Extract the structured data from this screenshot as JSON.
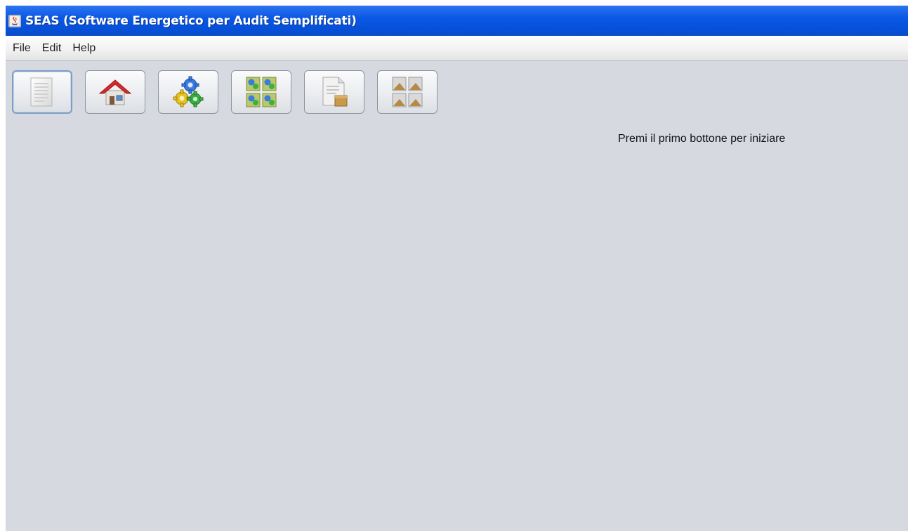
{
  "window": {
    "title": "SEAS (Software Energetico per Audit Semplificati)"
  },
  "menubar": {
    "items": [
      {
        "label": "File"
      },
      {
        "label": "Edit"
      },
      {
        "label": "Help"
      }
    ]
  },
  "toolbar": {
    "buttons": [
      {
        "icon": "document-icon"
      },
      {
        "icon": "home-icon"
      },
      {
        "icon": "gears-icon"
      },
      {
        "icon": "grid-gears-icon"
      },
      {
        "icon": "document-box-icon"
      },
      {
        "icon": "grid-images-icon"
      }
    ]
  },
  "main": {
    "hint": "Premi il primo bottone per iniziare"
  },
  "colors": {
    "titlebar": "#0a58e6",
    "background": "#d6d9df"
  }
}
